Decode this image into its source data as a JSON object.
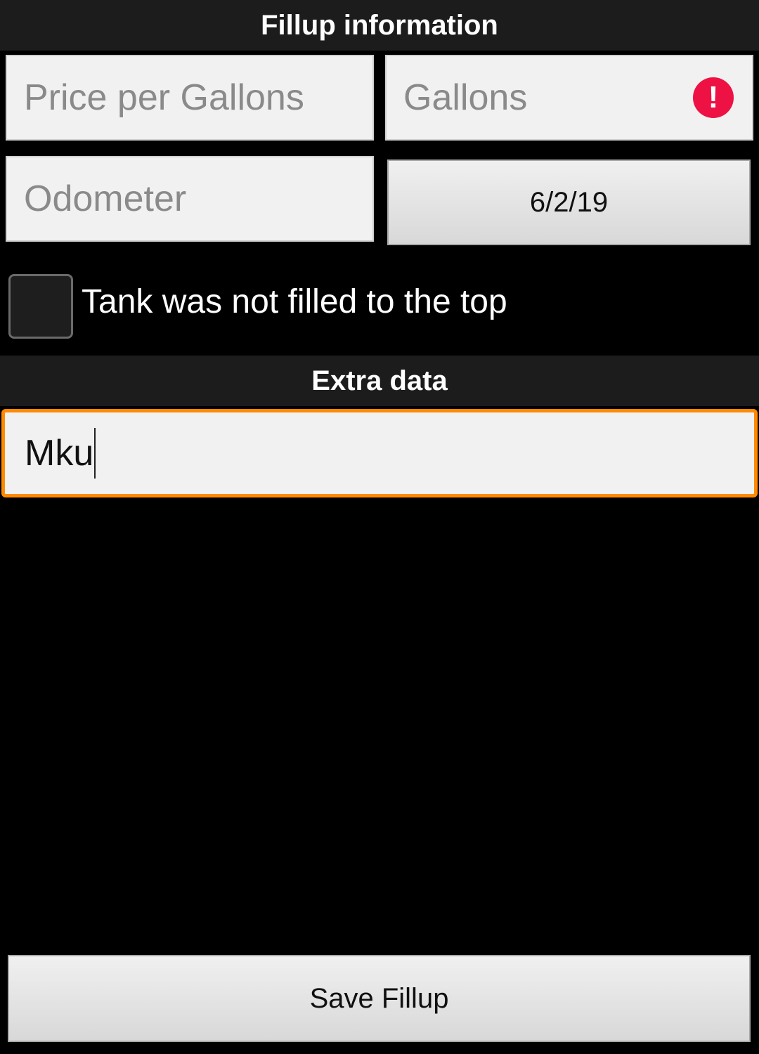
{
  "headers": {
    "fillup_information": "Fillup information",
    "extra_data": "Extra data"
  },
  "fields": {
    "price_per_gallons": {
      "value": "",
      "placeholder": "Price per Gallons"
    },
    "gallons": {
      "value": "",
      "placeholder": "Gallons",
      "error_icon": "exclamation-icon"
    },
    "odometer": {
      "value": "",
      "placeholder": "Odometer"
    },
    "extra": {
      "value": "Mku",
      "placeholder": ""
    }
  },
  "date_button": {
    "label": "6/2/19"
  },
  "checkbox": {
    "label": "Tank was not filled to the top",
    "checked": false
  },
  "save_button": {
    "label": "Save Fillup"
  },
  "colors": {
    "background": "#000000",
    "header_bg": "#1c1c1c",
    "field_bg": "#f1f1f1",
    "focus_accent": "#ff8a00",
    "error_red": "#ee1144"
  }
}
